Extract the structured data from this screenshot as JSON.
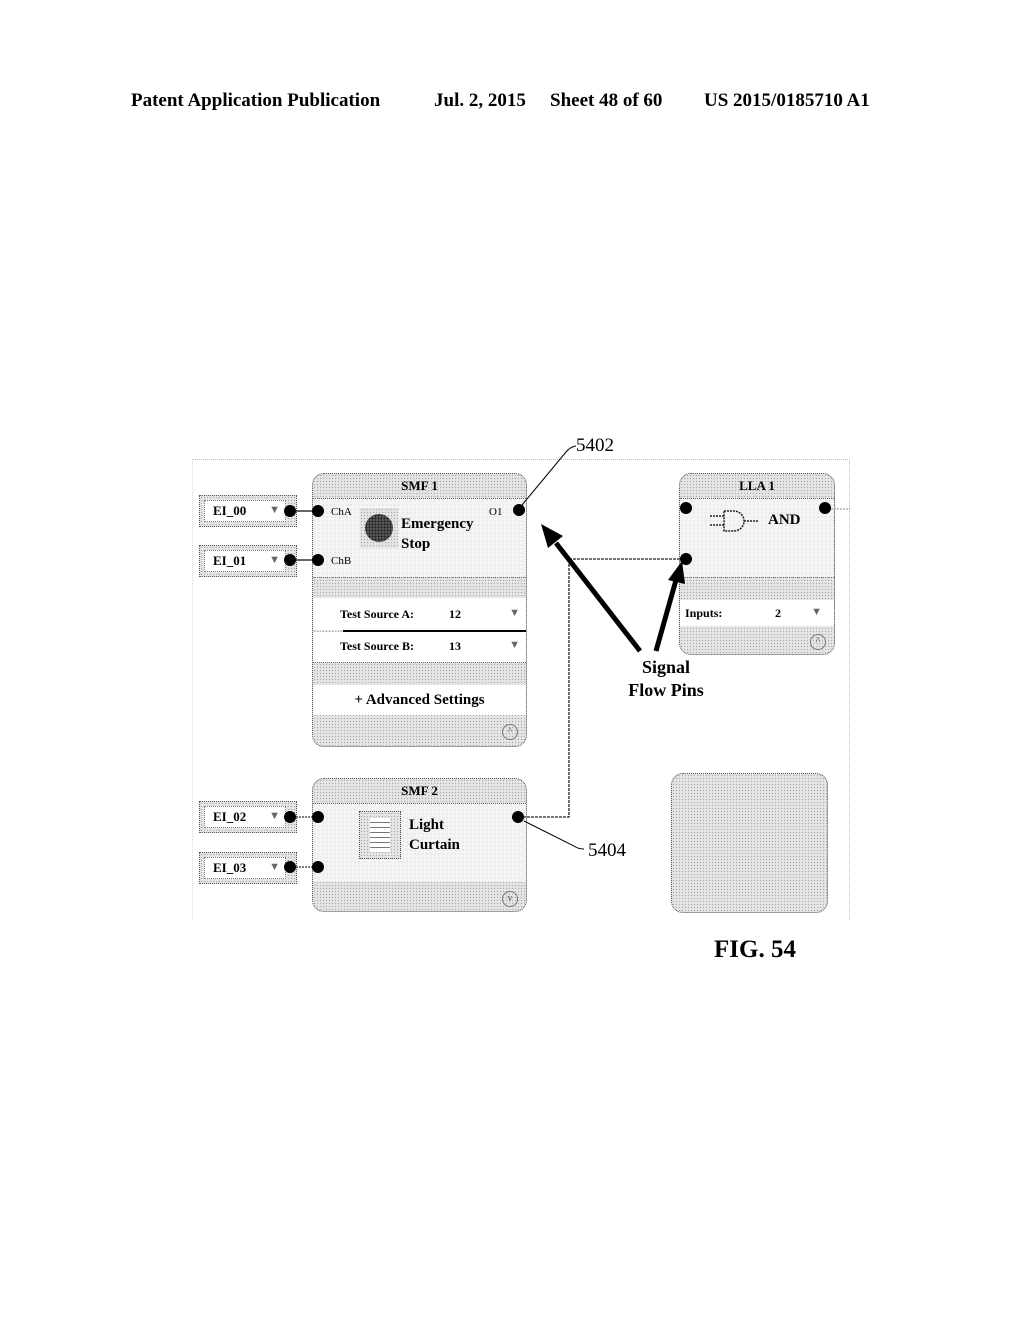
{
  "header": {
    "publication": "Patent Application Publication",
    "date": "Jul. 2, 2015",
    "sheet": "Sheet 48 of 60",
    "number": "US 2015/0185710 A1"
  },
  "tags": [
    {
      "label": "EI_00",
      "caret": "▼"
    },
    {
      "label": "EI_01",
      "caret": "▼"
    },
    {
      "label": "EI_02",
      "caret": "▼"
    },
    {
      "label": "EI_03",
      "caret": "▼"
    }
  ],
  "smf1": {
    "title": "SMF 1",
    "input_a": "ChA",
    "input_b": "ChB",
    "output": "O1",
    "device_line1": "Emergency",
    "device_line2": "Stop",
    "param_a_label": "Test Source A:",
    "param_a_value": "12",
    "param_b_label": "Test Source B:",
    "param_b_value": "13",
    "advanced": "+ Advanced Settings",
    "collapse": "^"
  },
  "smf2": {
    "title": "SMF 2",
    "device_line1": "Light",
    "device_line2": "Curtain",
    "collapse": "v"
  },
  "lla1": {
    "title": "LLA 1",
    "gate": "AND",
    "param_label": "Inputs:",
    "param_value": "2",
    "collapse": "^"
  },
  "annotations": {
    "ref_top": "5402",
    "ref_bottom": "5404",
    "callout_line1": "Signal",
    "callout_line2": "Flow Pins",
    "figure": "FIG. 54"
  }
}
